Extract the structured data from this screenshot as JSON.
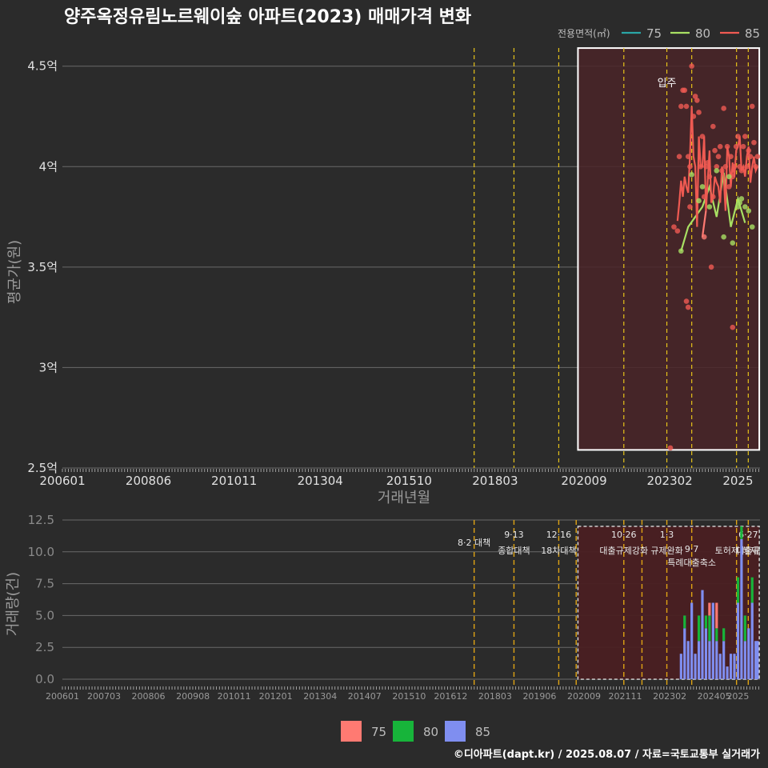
{
  "title": "양주옥정유림노르웨이숲 아파트(2023) 매매가격 변화",
  "caption": "©디아파트(dapt.kr) / 2025.08.07 / 자료=국토교통부 실거래가",
  "colors": {
    "background": "#2b2b2b",
    "grid": "#6a6a6a",
    "policy_line": "#e6c31a",
    "box_fill": "#4a2428",
    "c75": "#ff7a72",
    "c80": "#a8e063",
    "c85": "#ef5a52",
    "b75": "#ff7a72",
    "b80": "#17b43a",
    "b85": "#7f8ef0"
  },
  "chart_data": [
    {
      "type": "line",
      "title": "양주옥정유림노르웨이숲 아파트(2023) 매매가격 변화",
      "xlabel": "거래년월",
      "ylabel": "평균가(원)",
      "x_range": [
        2006.0,
        2025.62
      ],
      "ylim": [
        2.5,
        4.67
      ],
      "y_ticks": [
        2.5,
        3.0,
        3.5,
        4.0,
        4.5
      ],
      "y_tick_labels": [
        "2.5억",
        "3억",
        "3.5억",
        "4억",
        "4.5억"
      ],
      "x_ticks": [
        2006.0,
        2008.42,
        2010.83,
        2013.25,
        2015.75,
        2018.17,
        2020.67,
        2023.08,
        2025.0
      ],
      "x_tick_labels": [
        "200601",
        "200806",
        "201011",
        "201304",
        "201510",
        "201803",
        "202009",
        "202302",
        "2025"
      ],
      "legend_title": "전용면적(㎡)",
      "legend_position": "top-right",
      "annotation": {
        "label": "입주",
        "x": 2023.0
      },
      "highlight_box": {
        "x0": 2020.5,
        "x1": 2025.6,
        "y0": 2.59,
        "y1": 4.59
      },
      "policy_lines": [
        2017.58,
        2018.7,
        2019.96,
        2021.79,
        2023.0,
        2023.7,
        2024.96,
        2025.29
      ],
      "series": [
        {
          "name": "75",
          "x": [
            2024.0,
            2024.1
          ],
          "y": [
            3.65,
            3.78
          ]
        },
        {
          "name": "80",
          "x": [
            2023.4,
            2023.6,
            2023.8,
            2024.0,
            2024.2,
            2024.4,
            2024.6,
            2024.8,
            2025.0,
            2025.1,
            2025.2
          ],
          "y": [
            3.58,
            3.7,
            3.75,
            3.8,
            3.9,
            3.75,
            3.97,
            3.7,
            3.84,
            3.78,
            3.72
          ]
        },
        {
          "name": "85",
          "x": [
            2023.3,
            2023.35,
            2023.4,
            2023.45,
            2023.5,
            2023.55,
            2023.6,
            2023.65,
            2023.7,
            2023.75,
            2023.8,
            2023.85,
            2023.9,
            2023.95,
            2024.0,
            2024.05,
            2024.1,
            2024.15,
            2024.2,
            2024.25,
            2024.3,
            2024.35,
            2024.4,
            2024.45,
            2024.5,
            2024.55,
            2024.6,
            2024.65,
            2024.7,
            2024.75,
            2024.8,
            2024.85,
            2024.9,
            2024.95,
            2025.0,
            2025.05,
            2025.1,
            2025.15,
            2025.2,
            2025.25,
            2025.3,
            2025.35,
            2025.4,
            2025.45,
            2025.5,
            2025.55
          ],
          "y": [
            3.73,
            3.82,
            3.93,
            3.85,
            3.95,
            3.9,
            3.87,
            4.05,
            4.3,
            4.05,
            4.0,
            3.7,
            4.15,
            4.0,
            4.0,
            4.15,
            3.78,
            3.93,
            4.08,
            3.82,
            3.85,
            3.95,
            3.92,
            3.9,
            3.82,
            4.0,
            3.95,
            3.78,
            4.1,
            4.05,
            3.9,
            4.02,
            3.95,
            4.08,
            4.1,
            4.15,
            3.98,
            4.0,
            3.95,
            4.05,
            4.1,
            3.92,
            4.0,
            4.05,
            3.98,
            4.0
          ]
        }
      ],
      "scatter": {
        "75": {
          "x": [
            2024.05
          ],
          "y": [
            3.65
          ]
        },
        "80": {
          "x": [
            2023.4,
            2023.7,
            2023.9,
            2024.0,
            2024.2,
            2024.4,
            2024.6,
            2024.75,
            2024.85,
            2025.0,
            2025.05,
            2025.1,
            2025.2,
            2025.3,
            2025.4
          ],
          "y": [
            3.58,
            3.96,
            3.83,
            3.9,
            3.8,
            3.98,
            3.65,
            3.95,
            3.62,
            3.8,
            3.82,
            3.84,
            3.8,
            3.78,
            3.7
          ]
        },
        "85": {
          "x": [
            2023.1,
            2023.2,
            2023.3,
            2023.35,
            2023.4,
            2023.45,
            2023.5,
            2023.55,
            2023.6,
            2023.65,
            2023.7,
            2023.75,
            2023.8,
            2023.85,
            2023.9,
            2023.95,
            2024.0,
            2024.05,
            2024.1,
            2024.15,
            2024.2,
            2024.25,
            2024.3,
            2024.35,
            2024.4,
            2024.45,
            2024.5,
            2024.55,
            2024.6,
            2024.65,
            2024.7,
            2024.75,
            2024.8,
            2024.85,
            2024.9,
            2024.95,
            2025.0,
            2025.05,
            2025.1,
            2025.15,
            2025.2,
            2025.25,
            2025.3,
            2025.35,
            2025.4,
            2025.45,
            2025.5,
            2025.55,
            2023.55,
            2023.6,
            2023.65,
            2024.3,
            2024.85
          ],
          "y": [
            2.6,
            3.7,
            3.68,
            4.05,
            4.3,
            4.38,
            4.38,
            4.3,
            4.05,
            4.0,
            4.5,
            4.25,
            4.35,
            4.33,
            4.27,
            4.0,
            4.15,
            3.85,
            4.0,
            4.02,
            3.95,
            3.5,
            4.2,
            4.08,
            4.0,
            4.05,
            4.1,
            3.98,
            4.29,
            4.0,
            4.1,
            3.9,
            4.05,
            3.2,
            4.0,
            4.1,
            4.15,
            4.0,
            3.98,
            4.1,
            4.15,
            4.0,
            4.08,
            4.05,
            4.3,
            4.12,
            4.0,
            4.05,
            3.33,
            3.3,
            3.8,
            3.85,
            3.95
          ]
        }
      }
    },
    {
      "type": "bar",
      "xlabel": "",
      "ylabel": "거래량(건)",
      "x_range": [
        2006.0,
        2025.62
      ],
      "ylim": [
        -0.5,
        12.5
      ],
      "y_ticks": [
        0.0,
        2.5,
        5.0,
        7.5,
        10.0,
        12.5
      ],
      "y_tick_labels": [
        "0.0",
        "2.5",
        "5.0",
        "7.5",
        "10.0",
        "12.5"
      ],
      "x_ticks": [
        2006.0,
        2007.17,
        2008.42,
        2009.67,
        2010.83,
        2012.0,
        2013.25,
        2014.5,
        2015.75,
        2016.92,
        2018.17,
        2019.42,
        2020.67,
        2021.83,
        2023.08,
        2024.33,
        2025.0
      ],
      "x_tick_labels": [
        "200601",
        "200703",
        "200806",
        "200908",
        "201011",
        "201201",
        "201304",
        "201407",
        "201510",
        "201612",
        "201803",
        "201906",
        "202009",
        "202111",
        "202302",
        "202405",
        "2025"
      ],
      "highlight_box": {
        "x0": 2020.5,
        "x1": 2025.6,
        "y0": 0.0,
        "y1": 12.0
      },
      "policy_lines": [
        2017.58,
        2018.7,
        2019.96,
        2020.45,
        2021.79,
        2022.3,
        2023.0,
        2023.7,
        2024.96,
        2025.29
      ],
      "policy_labels": [
        {
          "date": "8·2",
          "name": "대책",
          "x": 2017.58
        },
        {
          "date": "9·13",
          "name": "종합대책",
          "x": 2018.7
        },
        {
          "date": "12·16",
          "name": "18차대책",
          "x": 2019.96
        },
        {
          "date": "10·26",
          "name": "대출규제강화",
          "x": 2021.79
        },
        {
          "date": "1·3",
          "name": "규제완화",
          "x": 2023.0
        },
        {
          "date": "9·7",
          "name": "특례대출축소",
          "x": 2023.7
        },
        {
          "date": "",
          "name": "토허제 해제",
          "x": 2024.96
        },
        {
          "date": "6·27",
          "name": "대출규",
          "x": 2025.29
        }
      ],
      "legend": [
        "75",
        "80",
        "85"
      ],
      "legend_position": "bottom",
      "months": [
        2023.4,
        2023.5,
        2023.6,
        2023.7,
        2023.8,
        2023.9,
        2024.0,
        2024.1,
        2024.2,
        2024.3,
        2024.4,
        2024.5,
        2024.6,
        2024.7,
        2024.8,
        2024.9,
        2025.0,
        2025.1,
        2025.2,
        2025.3,
        2025.4,
        2025.5,
        2025.55
      ],
      "series": [
        {
          "name": "85",
          "values": [
            2,
            4,
            3,
            6,
            2,
            3,
            7,
            4,
            3,
            6,
            3,
            2,
            3,
            1,
            2,
            2,
            6,
            11,
            3,
            4,
            6,
            3,
            3
          ]
        },
        {
          "name": "80",
          "values": [
            0,
            1,
            0,
            0,
            0,
            2,
            0,
            1,
            2,
            0,
            1,
            0,
            1,
            0,
            0,
            0,
            2,
            1,
            2,
            0,
            2,
            0,
            0
          ]
        },
        {
          "name": "75",
          "values": [
            0,
            0,
            0,
            0,
            0,
            0,
            0,
            0,
            1,
            0,
            2,
            0,
            0,
            0,
            0,
            0,
            0,
            0,
            0,
            0,
            0,
            0,
            0
          ]
        }
      ]
    }
  ]
}
